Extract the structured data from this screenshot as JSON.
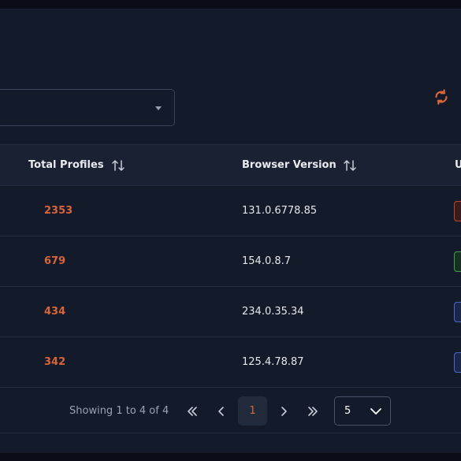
{
  "table": {
    "columns": [
      {
        "label": "Total Profiles"
      },
      {
        "label": "Browser Version"
      },
      {
        "label": "U"
      }
    ],
    "rows": [
      {
        "total_profiles": "2353",
        "browser_version": "131.0.6778.85",
        "badge_color": "#c2412d"
      },
      {
        "total_profiles": "679",
        "browser_version": "154.0.8.7",
        "badge_color": "#3f9d4a"
      },
      {
        "total_profiles": "434",
        "browser_version": "234.0.35.34",
        "badge_color": "#4a68c8"
      },
      {
        "total_profiles": "342",
        "browser_version": "125.4.78.87",
        "badge_color": "#4a68c8"
      }
    ]
  },
  "pagination": {
    "showing": "Showing 1 to 4 of 4",
    "current_page": "1",
    "page_size": "5"
  },
  "colors": {
    "accent": "#d8643a",
    "background": "#131a29",
    "header_bg": "#192132"
  },
  "icons": {
    "refresh": "refresh-icon",
    "sort": "sort-arrows-icon",
    "first": "double-chevron-left-icon",
    "prev": "chevron-left-icon",
    "next": "chevron-right-icon",
    "last": "double-chevron-right-icon",
    "dropdown": "chevron-down-icon"
  }
}
